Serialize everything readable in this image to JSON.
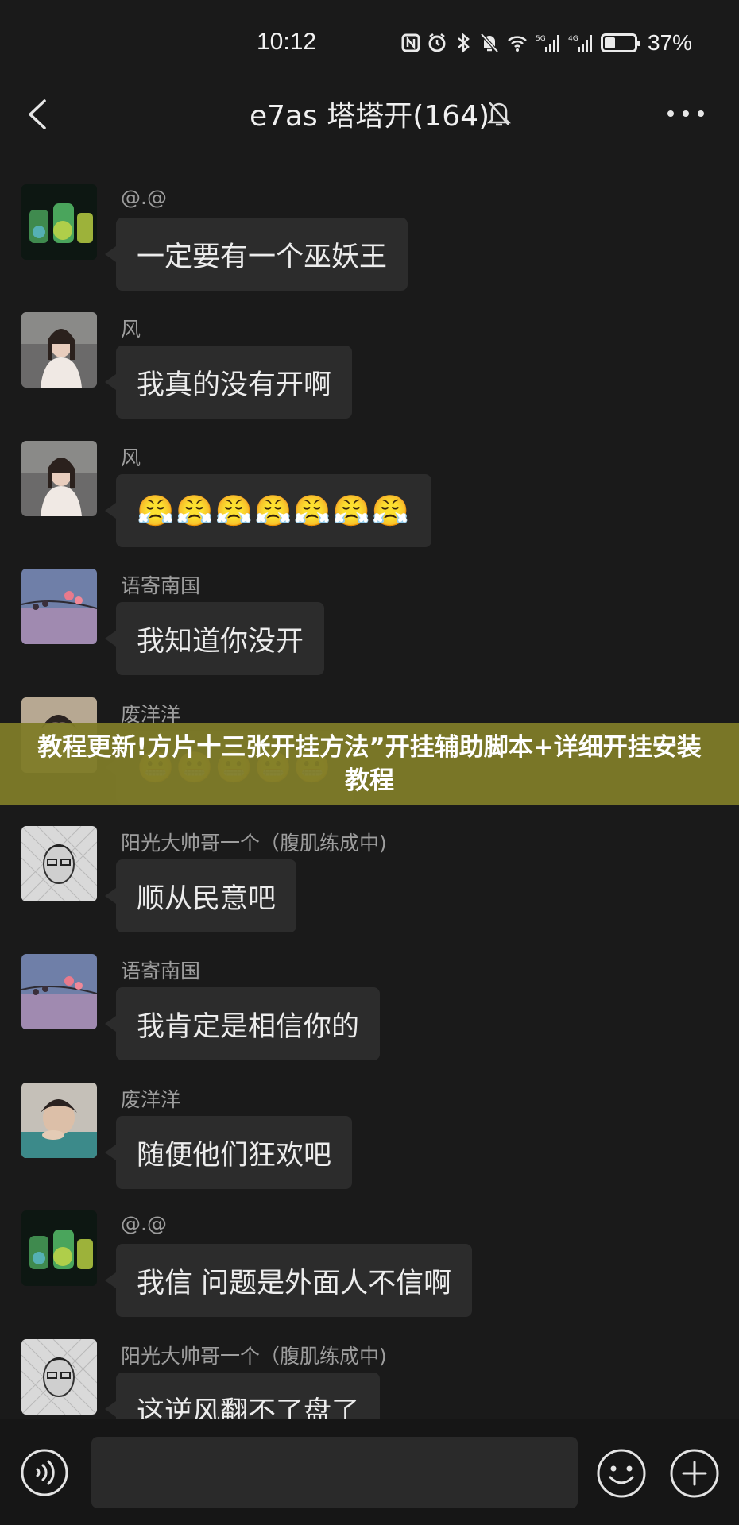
{
  "status_bar": {
    "time": "10:12",
    "battery_percent": "37%",
    "battery_level": 0.37,
    "icons": [
      "nfc-icon",
      "alarm-icon",
      "bluetooth-icon",
      "mute-icon",
      "wifi-icon",
      "signal-5g-icon",
      "signal-4g-icon",
      "battery-icon"
    ]
  },
  "header": {
    "title": "e7as 塔塔开(164)",
    "back_icon": "chevron-left-icon",
    "mute_icon": "bell-off-icon",
    "more_icon": "more-icon"
  },
  "messages": [
    {
      "sender": "@.@",
      "text": "一定要有一个巫妖王",
      "avatar": "glowing-jars"
    },
    {
      "sender": "风",
      "text": "我真的没有开啊",
      "avatar": "girl-photo"
    },
    {
      "sender": "风",
      "text": "😤😤😤😤😤😤😤",
      "avatar": "girl-photo"
    },
    {
      "sender": "语寄南国",
      "text": "我知道你没开",
      "avatar": "sky-flowers"
    },
    {
      "sender": "废洋洋",
      "text": "😬😬😬😬😬",
      "avatar": "boy-photo"
    },
    {
      "sender": "阳光大帅哥一个（腹肌练成中)",
      "text": "顺从民意吧",
      "avatar": "man-sketch"
    },
    {
      "sender": "语寄南国",
      "text": "我肯定是相信你的",
      "avatar": "sky-flowers"
    },
    {
      "sender": "废洋洋",
      "text": "随便他们狂欢吧",
      "avatar": "boy-photo"
    },
    {
      "sender": "@.@",
      "text": "我信 问题是外面人不信啊",
      "avatar": "glowing-jars"
    },
    {
      "sender": "阳光大帅哥一个（腹肌练成中)",
      "text": "这逆风翻不了盘了",
      "avatar": "man-sketch"
    }
  ],
  "banner": {
    "text": "教程更新!方片十三张开挂方法”开挂辅助脚本+详细开挂安装教程"
  },
  "input_bar": {
    "voice_icon": "voice-icon",
    "input_value": "",
    "emoji_icon": "emoji-icon",
    "plus_icon": "plus-icon"
  },
  "colors": {
    "background": "#1a1a1a",
    "bubble": "#2c2c2c",
    "sender_text": "#9d9d9d",
    "banner": "#7e7b28"
  }
}
